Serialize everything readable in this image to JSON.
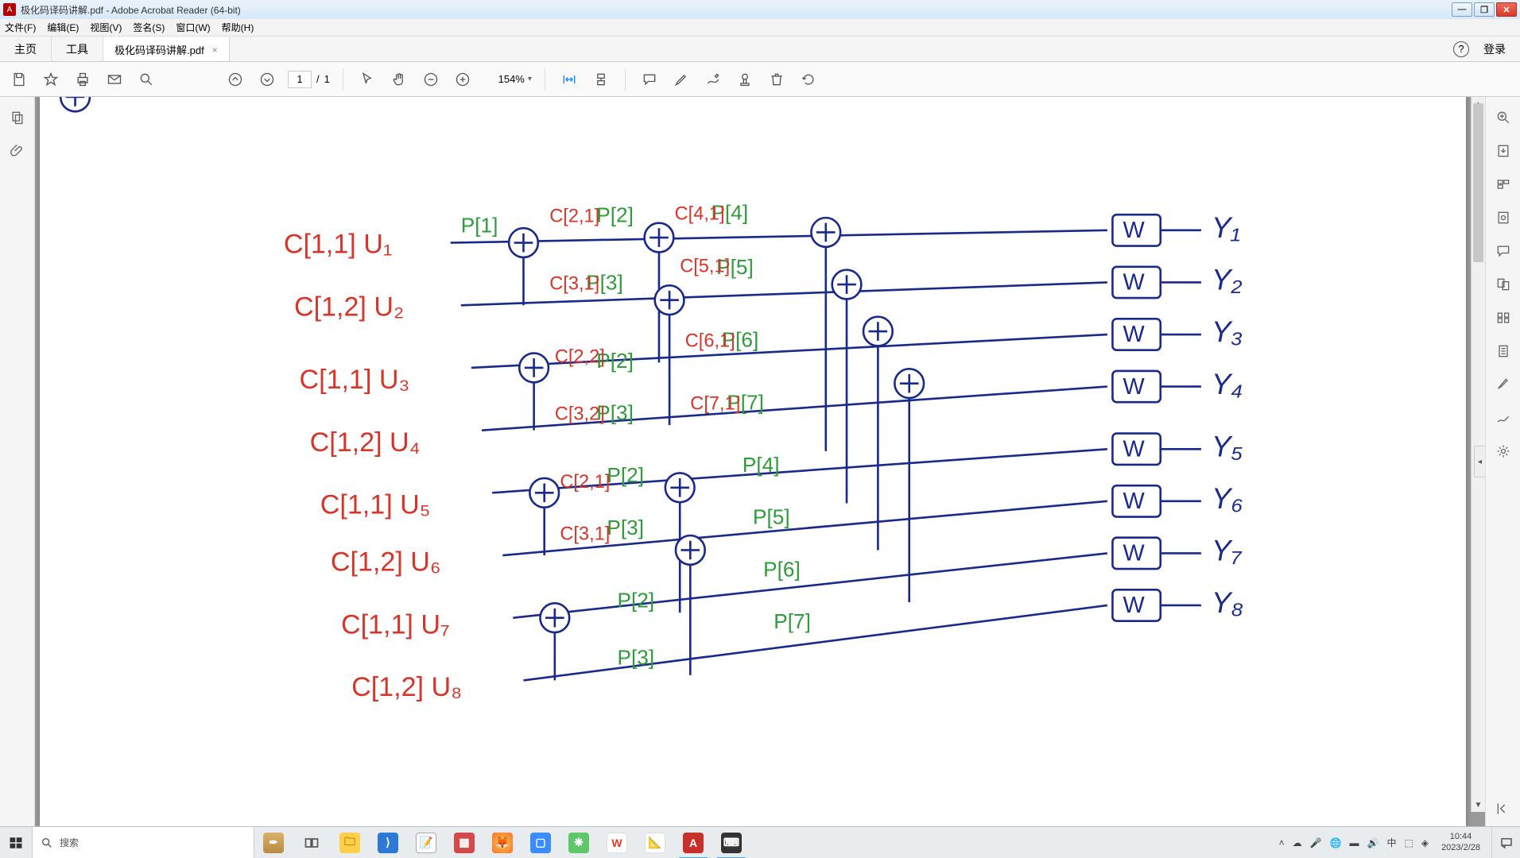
{
  "window": {
    "title": "极化码译码讲解.pdf - Adobe Acrobat Reader (64-bit)",
    "min": "—",
    "max": "❐",
    "close": "✕"
  },
  "menu": {
    "file": "文件(F)",
    "edit": "编辑(E)",
    "view": "视图(V)",
    "sign": "签名(S)",
    "window": "窗口(W)",
    "help": "帮助(H)"
  },
  "tabs": {
    "home": "主页",
    "tools": "工具",
    "doc": "极化码译码讲解.pdf",
    "close_x": "×",
    "help_q": "?",
    "login": "登录"
  },
  "toolbar": {
    "page_current": "1",
    "page_sep": "/",
    "page_total": "1",
    "zoom_value": "154%",
    "zoom_dd": "▾"
  },
  "document": {
    "description": "Hand-drawn polar code decoding butterfly diagram with inputs U1..U8, outputs Y1..Y8, XOR gates and W channel boxes.",
    "inputs": [
      "C[1,1]  U₁",
      "C[1,2]  U₂",
      "C[1,1]  U₃",
      "C[1,2]  U₄",
      "C[1,1]  U₅",
      "C[1,2]  U₆",
      "C[1,1]  U₇",
      "C[1,2]  U₈"
    ],
    "outputs": [
      "Y₁",
      "Y₂",
      "Y₃",
      "Y₄",
      "Y₅",
      "Y₆",
      "Y₇",
      "Y₈"
    ],
    "w_label": "W",
    "p_labels": [
      "P[1]",
      "P[2]",
      "P[3]",
      "P[4]",
      "P[5]",
      "P[6]",
      "P[7]"
    ],
    "c_labels": [
      "C[2,1]",
      "C[3,1]",
      "C[2,2]",
      "C[3,2]",
      "C[4,1]",
      "C[5,1]",
      "C[6,1]",
      "C[7,1]"
    ]
  },
  "taskbar": {
    "search_placeholder": "搜索",
    "clock_time": "10:44",
    "clock_date": "2023/2/28",
    "tray_up": "˄"
  }
}
